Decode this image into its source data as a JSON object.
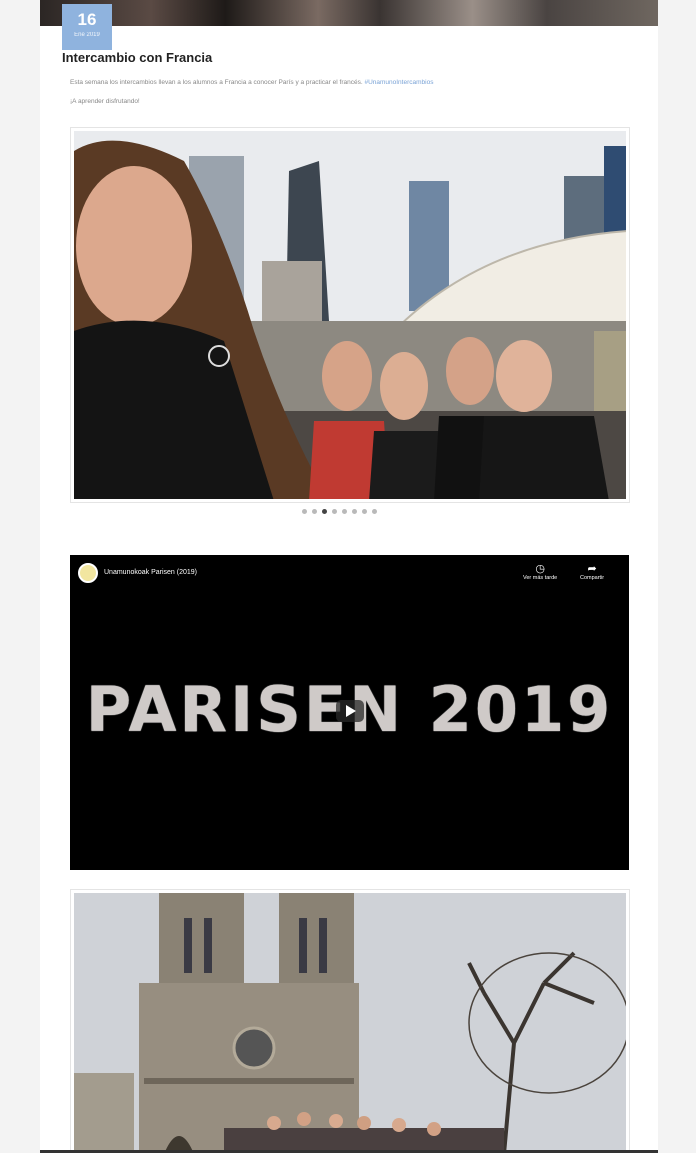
{
  "post": {
    "date_day": "16",
    "date_month": "Ene 2019",
    "title": "Intercambio con Francia",
    "text": "Esta semana los intercambios llevan a los alumnos a Francia a conocer París y a practicar el francés.",
    "hashtag": "#UnamunoIntercambios",
    "text2": "¡A aprender disfrutando!"
  },
  "carousel": {
    "dot_count": 8,
    "active_index": 2
  },
  "video": {
    "channel_title": "Unamunokoak Parisen (2019)",
    "watch_later_label": "Ver más tarde",
    "share_label": "Compartir",
    "headline": "PARISEN 2019",
    "watch_later_icon": "clock-icon",
    "share_icon": "share-arrow-icon"
  },
  "colors": {
    "date_badge": "#8fb3de",
    "hashtag_link": "#7aa3d6"
  }
}
